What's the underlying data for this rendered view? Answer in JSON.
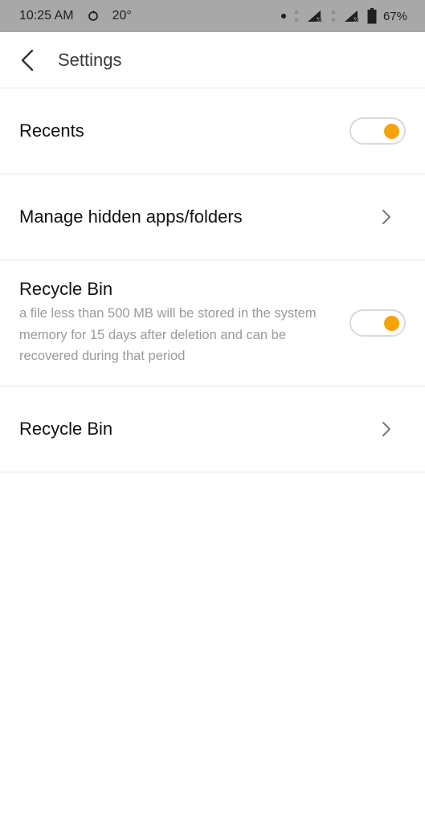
{
  "status_bar": {
    "time": "10:25 AM",
    "temperature": "20°",
    "battery": "67%",
    "icons": [
      "sync-icon",
      "dot-icon",
      "data-arrows-icon",
      "signal-icon",
      "signal-icon",
      "battery-icon"
    ]
  },
  "header": {
    "title": "Settings",
    "back_icon": "chevron-left-icon"
  },
  "settings": [
    {
      "label": "Recents",
      "control": "toggle",
      "on": true
    },
    {
      "label": "Manage hidden apps/folders",
      "control": "chevron"
    },
    {
      "label": "Recycle Bin",
      "description": "a file less than 500 MB will be stored in the system memory for 15 days after deletion and can be recovered during that period",
      "control": "toggle",
      "on": true
    },
    {
      "label": "Recycle Bin",
      "control": "chevron"
    }
  ],
  "colors": {
    "accent": "#f7a30b",
    "status_bar": "#a8a8a8",
    "divider": "#e6e6e6",
    "description_text": "#9a9a9a"
  }
}
